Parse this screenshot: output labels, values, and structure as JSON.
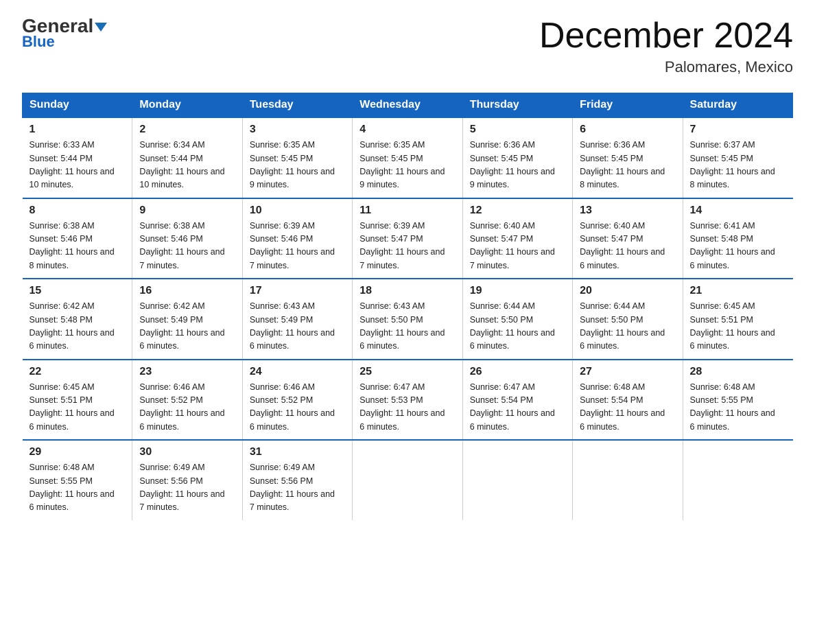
{
  "logo": {
    "part1": "General",
    "part2": "Blue"
  },
  "header": {
    "month": "December 2024",
    "location": "Palomares, Mexico"
  },
  "days_of_week": [
    "Sunday",
    "Monday",
    "Tuesday",
    "Wednesday",
    "Thursday",
    "Friday",
    "Saturday"
  ],
  "weeks": [
    [
      {
        "day": "1",
        "sunrise": "6:33 AM",
        "sunset": "5:44 PM",
        "daylight": "11 hours and 10 minutes."
      },
      {
        "day": "2",
        "sunrise": "6:34 AM",
        "sunset": "5:44 PM",
        "daylight": "11 hours and 10 minutes."
      },
      {
        "day": "3",
        "sunrise": "6:35 AM",
        "sunset": "5:45 PM",
        "daylight": "11 hours and 9 minutes."
      },
      {
        "day": "4",
        "sunrise": "6:35 AM",
        "sunset": "5:45 PM",
        "daylight": "11 hours and 9 minutes."
      },
      {
        "day": "5",
        "sunrise": "6:36 AM",
        "sunset": "5:45 PM",
        "daylight": "11 hours and 9 minutes."
      },
      {
        "day": "6",
        "sunrise": "6:36 AM",
        "sunset": "5:45 PM",
        "daylight": "11 hours and 8 minutes."
      },
      {
        "day": "7",
        "sunrise": "6:37 AM",
        "sunset": "5:45 PM",
        "daylight": "11 hours and 8 minutes."
      }
    ],
    [
      {
        "day": "8",
        "sunrise": "6:38 AM",
        "sunset": "5:46 PM",
        "daylight": "11 hours and 8 minutes."
      },
      {
        "day": "9",
        "sunrise": "6:38 AM",
        "sunset": "5:46 PM",
        "daylight": "11 hours and 7 minutes."
      },
      {
        "day": "10",
        "sunrise": "6:39 AM",
        "sunset": "5:46 PM",
        "daylight": "11 hours and 7 minutes."
      },
      {
        "day": "11",
        "sunrise": "6:39 AM",
        "sunset": "5:47 PM",
        "daylight": "11 hours and 7 minutes."
      },
      {
        "day": "12",
        "sunrise": "6:40 AM",
        "sunset": "5:47 PM",
        "daylight": "11 hours and 7 minutes."
      },
      {
        "day": "13",
        "sunrise": "6:40 AM",
        "sunset": "5:47 PM",
        "daylight": "11 hours and 6 minutes."
      },
      {
        "day": "14",
        "sunrise": "6:41 AM",
        "sunset": "5:48 PM",
        "daylight": "11 hours and 6 minutes."
      }
    ],
    [
      {
        "day": "15",
        "sunrise": "6:42 AM",
        "sunset": "5:48 PM",
        "daylight": "11 hours and 6 minutes."
      },
      {
        "day": "16",
        "sunrise": "6:42 AM",
        "sunset": "5:49 PM",
        "daylight": "11 hours and 6 minutes."
      },
      {
        "day": "17",
        "sunrise": "6:43 AM",
        "sunset": "5:49 PM",
        "daylight": "11 hours and 6 minutes."
      },
      {
        "day": "18",
        "sunrise": "6:43 AM",
        "sunset": "5:50 PM",
        "daylight": "11 hours and 6 minutes."
      },
      {
        "day": "19",
        "sunrise": "6:44 AM",
        "sunset": "5:50 PM",
        "daylight": "11 hours and 6 minutes."
      },
      {
        "day": "20",
        "sunrise": "6:44 AM",
        "sunset": "5:50 PM",
        "daylight": "11 hours and 6 minutes."
      },
      {
        "day": "21",
        "sunrise": "6:45 AM",
        "sunset": "5:51 PM",
        "daylight": "11 hours and 6 minutes."
      }
    ],
    [
      {
        "day": "22",
        "sunrise": "6:45 AM",
        "sunset": "5:51 PM",
        "daylight": "11 hours and 6 minutes."
      },
      {
        "day": "23",
        "sunrise": "6:46 AM",
        "sunset": "5:52 PM",
        "daylight": "11 hours and 6 minutes."
      },
      {
        "day": "24",
        "sunrise": "6:46 AM",
        "sunset": "5:52 PM",
        "daylight": "11 hours and 6 minutes."
      },
      {
        "day": "25",
        "sunrise": "6:47 AM",
        "sunset": "5:53 PM",
        "daylight": "11 hours and 6 minutes."
      },
      {
        "day": "26",
        "sunrise": "6:47 AM",
        "sunset": "5:54 PM",
        "daylight": "11 hours and 6 minutes."
      },
      {
        "day": "27",
        "sunrise": "6:48 AM",
        "sunset": "5:54 PM",
        "daylight": "11 hours and 6 minutes."
      },
      {
        "day": "28",
        "sunrise": "6:48 AM",
        "sunset": "5:55 PM",
        "daylight": "11 hours and 6 minutes."
      }
    ],
    [
      {
        "day": "29",
        "sunrise": "6:48 AM",
        "sunset": "5:55 PM",
        "daylight": "11 hours and 6 minutes."
      },
      {
        "day": "30",
        "sunrise": "6:49 AM",
        "sunset": "5:56 PM",
        "daylight": "11 hours and 7 minutes."
      },
      {
        "day": "31",
        "sunrise": "6:49 AM",
        "sunset": "5:56 PM",
        "daylight": "11 hours and 7 minutes."
      },
      null,
      null,
      null,
      null
    ]
  ],
  "labels": {
    "sunrise": "Sunrise:",
    "sunset": "Sunset:",
    "daylight": "Daylight:"
  }
}
